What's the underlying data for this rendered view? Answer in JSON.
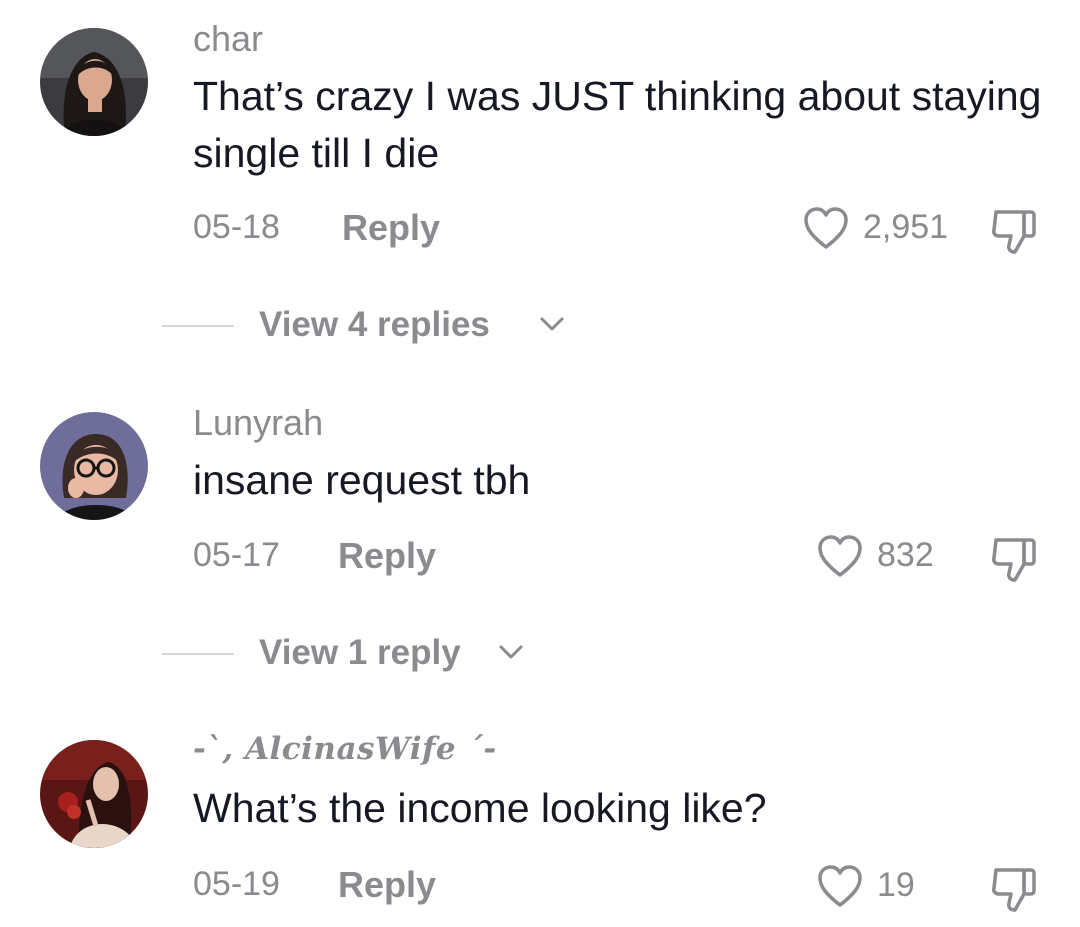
{
  "comments": [
    {
      "username": "char",
      "text": "That’s crazy I was JUST thinking about staying single till I die",
      "date": "05-18",
      "reply_label": "Reply",
      "likes": "2,951",
      "view_replies_label": "View 4 replies",
      "avatar_icon": "avatar-woman-dark-hair"
    },
    {
      "username": "Lunyrah",
      "text": "insane request tbh",
      "date": "05-17",
      "reply_label": "Reply",
      "likes": "832",
      "view_replies_label": "View 1 reply",
      "avatar_icon": "avatar-cartoon-glasses"
    },
    {
      "username": "-`, AlcinasWife ´-",
      "text": "What’s the income looking like?",
      "date": "05-19",
      "reply_label": "Reply",
      "likes": "19",
      "avatar_icon": "avatar-woman-red-dress"
    }
  ],
  "icons": {
    "like": "heart-outline-icon",
    "dislike": "thumbs-down-icon",
    "expand": "chevron-down-icon"
  },
  "colors": {
    "text_primary": "#161823",
    "text_secondary": "#8a8a8f",
    "divider": "#d5d5d8"
  }
}
